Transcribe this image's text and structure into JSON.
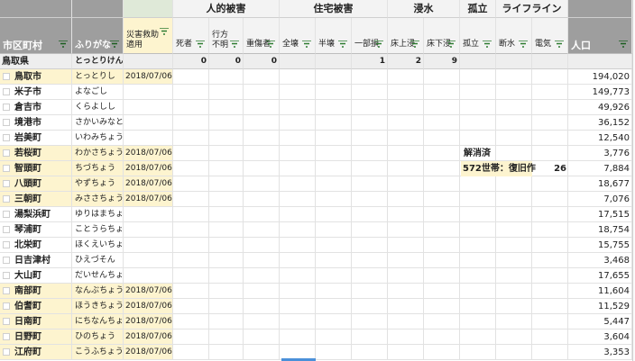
{
  "header": {
    "groups": {
      "human_damage": "人的被害",
      "housing_damage": "住宅被害",
      "flooding": "浸水",
      "isolation": "孤立",
      "lifeline": "ライフライン"
    },
    "columns": {
      "municipality": "市区町村",
      "furigana": "ふりがな",
      "relief_line1": "災害救助",
      "relief_line2": "適用",
      "dead": "死者",
      "missing_line1": "行方",
      "missing_line2": "不明",
      "injured": "重傷者",
      "total_destroyed": "全壊",
      "half_destroyed": "半壊",
      "partial": "一部損",
      "above_floor": "床上浸",
      "below_floor": "床下浸",
      "isolated": "孤立",
      "water_outage": "断水",
      "power": "電気",
      "population": "人口"
    }
  },
  "prefecture": {
    "name": "鳥取県",
    "kana": "とっとりけん",
    "dead": "0",
    "missing": "0",
    "injured": "0",
    "partial": "1",
    "above_floor": "2",
    "below_floor": "9"
  },
  "rows": [
    {
      "name": "鳥取市",
      "kana": "とっとりし",
      "date": "2018/07/06",
      "pop": "194,020",
      "yellow": true
    },
    {
      "name": "米子市",
      "kana": "よなごし",
      "date": "",
      "pop": "149,773",
      "yellow": false
    },
    {
      "name": "倉吉市",
      "kana": "くらよしし",
      "date": "",
      "pop": "49,926",
      "yellow": false
    },
    {
      "name": "境港市",
      "kana": "さかいみなとし",
      "date": "",
      "pop": "36,152",
      "yellow": false
    },
    {
      "name": "岩美町",
      "kana": "いわみちょう",
      "date": "",
      "pop": "12,540",
      "yellow": false
    },
    {
      "name": "若桜町",
      "kana": "わかさちょう",
      "date": "2018/07/06",
      "pop": "3,776",
      "yellow": true
    },
    {
      "name": "智頭町",
      "kana": "ちづちょう",
      "date": "2018/07/06",
      "pop": "7,884",
      "yellow": true
    },
    {
      "name": "八頭町",
      "kana": "やずちょう",
      "date": "2018/07/06",
      "pop": "18,677",
      "yellow": true
    },
    {
      "name": "三朝町",
      "kana": "みささちょう",
      "date": "2018/07/06",
      "pop": "7,076",
      "yellow": true
    },
    {
      "name": "湯梨浜町",
      "kana": "ゆりはまちょう",
      "date": "",
      "pop": "17,515",
      "yellow": false
    },
    {
      "name": "琴浦町",
      "kana": "ことうらちょう",
      "date": "",
      "pop": "18,754",
      "yellow": false
    },
    {
      "name": "北栄町",
      "kana": "ほくえいちょう",
      "date": "",
      "pop": "15,755",
      "yellow": false
    },
    {
      "name": "日吉津村",
      "kana": "ひえづそん",
      "date": "",
      "pop": "3,468",
      "yellow": false
    },
    {
      "name": "大山町",
      "kana": "だいせんちょう",
      "date": "",
      "pop": "17,655",
      "yellow": false
    },
    {
      "name": "南部町",
      "kana": "なんぶちょう",
      "date": "2018/07/06",
      "pop": "11,604",
      "yellow": true
    },
    {
      "name": "伯耆町",
      "kana": "ほうきちょう",
      "date": "2018/07/06",
      "pop": "11,529",
      "yellow": true
    },
    {
      "name": "日南町",
      "kana": "にちなんちょう",
      "date": "2018/07/06",
      "pop": "5,447",
      "yellow": true
    },
    {
      "name": "日野町",
      "kana": "ひのちょう",
      "date": "2018/07/06",
      "pop": "3,604",
      "yellow": true
    },
    {
      "name": "江府町",
      "kana": "こうふちょう",
      "date": "2018/07/06",
      "pop": "3,353",
      "yellow": true
    }
  ],
  "notes": {
    "resolved": "解消済",
    "restoration": "572世帯：復旧作",
    "restoration_count": "26"
  },
  "colors": {
    "header_dark": "#9e9e9e",
    "header_light": "#f3f3f3",
    "highlight_yellow": "#fdf4cf",
    "filter_green": "#2e7d32",
    "selection_blue": "#4a90d9"
  },
  "icons": {
    "filter": "filter-funnel-icon",
    "checkbox": "checkbox-icon"
  }
}
